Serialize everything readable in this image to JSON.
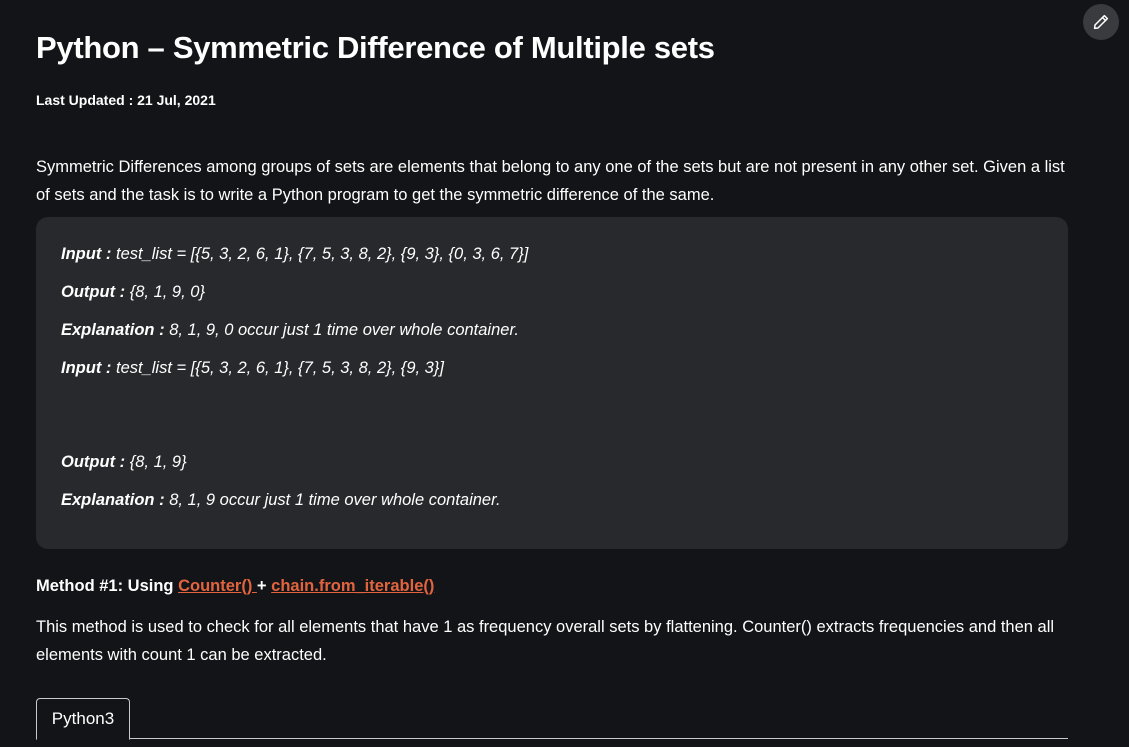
{
  "article": {
    "title": "Python – Symmetric Difference of Multiple sets",
    "last_updated": "Last Updated : 21 Jul, 2021",
    "intro": "Symmetric Differences among groups of sets are elements that belong to any one of the sets but are not present in any other set. Given a list of sets and the task is to write a Python program to get the symmetric difference of the same."
  },
  "examples": [
    {
      "label": "Input : ",
      "value": "test_list = [{5, 3, 2, 6, 1}, {7, 5, 3, 8, 2}, {9, 3}, {0, 3, 6, 7}]"
    },
    {
      "label": "Output : ",
      "value": "{8, 1, 9, 0}"
    },
    {
      "label": "Explanation : ",
      "value": "8, 1, 9, 0 occur just 1 time over whole container."
    },
    {
      "label": "Input : ",
      "value": "test_list = [{5, 3, 2, 6, 1}, {7, 5, 3, 8, 2}, {9, 3}]"
    },
    {
      "label": "Output : ",
      "value": "{8, 1, 9}"
    },
    {
      "label": "Explanation : ",
      "value": "8, 1, 9 occur just 1 time over whole container."
    }
  ],
  "method": {
    "prefix": "Method #1: Using ",
    "link1": "Counter() ",
    "plus": "+ ",
    "link2": "chain.from_iterable() ",
    "description": "This method is used to check for all elements that have 1 as frequency overall sets by flattening. Counter() extracts frequencies and then all elements with count 1 can be extracted."
  },
  "code_tabs": [
    "Python3"
  ],
  "icons": {
    "edit": "pencil-icon"
  },
  "colors": {
    "background": "#131417",
    "box": "#28292c",
    "link": "#e2643f"
  }
}
